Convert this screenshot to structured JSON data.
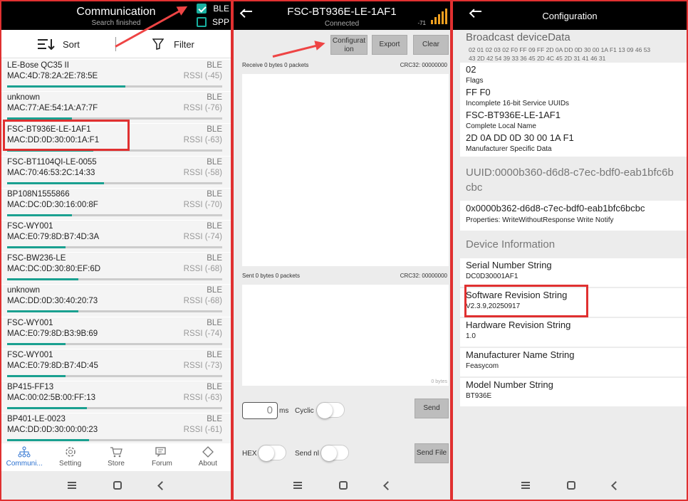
{
  "scan": {
    "title": "Communication",
    "subtitle": "Search finished",
    "ble": "BLE",
    "spp": "SPP",
    "sort": "Sort",
    "filter": "Filter",
    "devices": [
      {
        "name": "LE-Bose QC35 II",
        "mac": "MAC:4D:78:2A:2E:78:5E",
        "type": "BLE",
        "rssi": "RSSI (-45)",
        "signal": 0.55
      },
      {
        "name": "unknown",
        "mac": "MAC:77:AE:54:1A:A7:7F",
        "type": "BLE",
        "rssi": "RSSI (-76)",
        "signal": 0.3
      },
      {
        "name": "FSC-BT936E-LE-1AF1",
        "mac": "MAC:DD:0D:30:00:1A:F1",
        "type": "BLE",
        "rssi": "RSSI (-63)",
        "signal": 0.4
      },
      {
        "name": "FSC-BT1104QI-LE-0055",
        "mac": "MAC:70:46:53:2C:14:33",
        "type": "BLE",
        "rssi": "RSSI (-58)",
        "signal": 0.45
      },
      {
        "name": "BP108N1555866",
        "mac": "MAC:DC:0D:30:16:00:8F",
        "type": "BLE",
        "rssi": "RSSI (-70)",
        "signal": 0.3
      },
      {
        "name": "FSC-WY001",
        "mac": "MAC:E0:79:8D:B7:4D:3A",
        "type": "BLE",
        "rssi": "RSSI (-74)",
        "signal": 0.27
      },
      {
        "name": "FSC-BW236-LE",
        "mac": "MAC:DC:0D:30:80:EF:6D",
        "type": "BLE",
        "rssi": "RSSI (-68)",
        "signal": 0.33
      },
      {
        "name": "unknown",
        "mac": "MAC:DD:0D:30:40:20:73",
        "type": "BLE",
        "rssi": "RSSI (-68)",
        "signal": 0.33
      },
      {
        "name": "FSC-WY001",
        "mac": "MAC:E0:79:8D:B3:9B:69",
        "type": "BLE",
        "rssi": "RSSI (-74)",
        "signal": 0.27
      },
      {
        "name": "FSC-WY001",
        "mac": "MAC:E0:79:8D:B7:4D:45",
        "type": "BLE",
        "rssi": "RSSI (-73)",
        "signal": 0.27
      },
      {
        "name": "BP415-FF13",
        "mac": "MAC:00:02:5B:00:FF:13",
        "type": "BLE",
        "rssi": "RSSI (-63)",
        "signal": 0.37
      },
      {
        "name": "BP401-LE-0023",
        "mac": "MAC:DD:0D:30:00:00:23",
        "type": "BLE",
        "rssi": "RSSI (-61)",
        "signal": 0.38
      }
    ],
    "tabs": [
      "Communi...",
      "Setting",
      "Store",
      "Forum",
      "About"
    ]
  },
  "conn": {
    "title": "FSC-BT936E-LE-1AF1",
    "status": "Connected",
    "rssi": "-71",
    "config_btn": "Configurat ion",
    "export_btn": "Export",
    "clear_btn": "Clear",
    "receive_label": "Receive 0 bytes 0 packets",
    "receive_crc": "CRC32: 00000000",
    "sent_label": "Sent 0 bytes 0 packets",
    "sent_crc": "CRC32: 00000000",
    "sent_bytes": "0 bytes",
    "interval": "0",
    "ms": "ms",
    "cyclic": "Cyclic",
    "send_btn": "Send",
    "hex": "HEX",
    "send_nl": "Send nl",
    "send_file_btn": "Send File"
  },
  "config": {
    "title": "Configuration",
    "broadcast_title": "Broadcast deviceData",
    "broadcast_hex1": "02 01 02 03 02 F0 FF 09 FF 2D 0A DD 0D 30 00 1A F1 13 09 46 53",
    "broadcast_hex2": "43 2D 42 54 39 33 36 45 2D 4C 45 2D 31 41 46 31",
    "ad": [
      {
        "v": "02",
        "k": "Flags"
      },
      {
        "v": "FF F0",
        "k": "Incomplete 16-bit Service UUIDs"
      },
      {
        "v": "FSC-BT936E-LE-1AF1",
        "k": "Complete Local Name"
      },
      {
        "v": "2D 0A DD 0D 30 00 1A F1",
        "k": "Manufacturer Specific Data"
      }
    ],
    "uuid_title1": "UUID:0000b360-d6d8-c7ec-bdf0-eab1bfc6b",
    "uuid_title2": "cbc",
    "char_uuid": "0x0000b362-d6d8-c7ec-bdf0-eab1bfc6bcbc",
    "char_props": "Properties:  WriteWithoutResponse Write Notify",
    "devinfo_title": "Device Information",
    "info": [
      {
        "k": "Serial Number String",
        "v": "DC0D30001AF1"
      },
      {
        "k": "Software Revision String",
        "v": "V2.3.9,20250917"
      },
      {
        "k": "Hardware Revision String",
        "v": "1.0"
      },
      {
        "k": "Manufacturer Name String",
        "v": "Feasycom"
      },
      {
        "k": "Model Number String",
        "v": "BT936E"
      }
    ]
  },
  "colors": {
    "accent": "#1aa090",
    "highlight": "#e03030",
    "signal": "#f0a020"
  }
}
